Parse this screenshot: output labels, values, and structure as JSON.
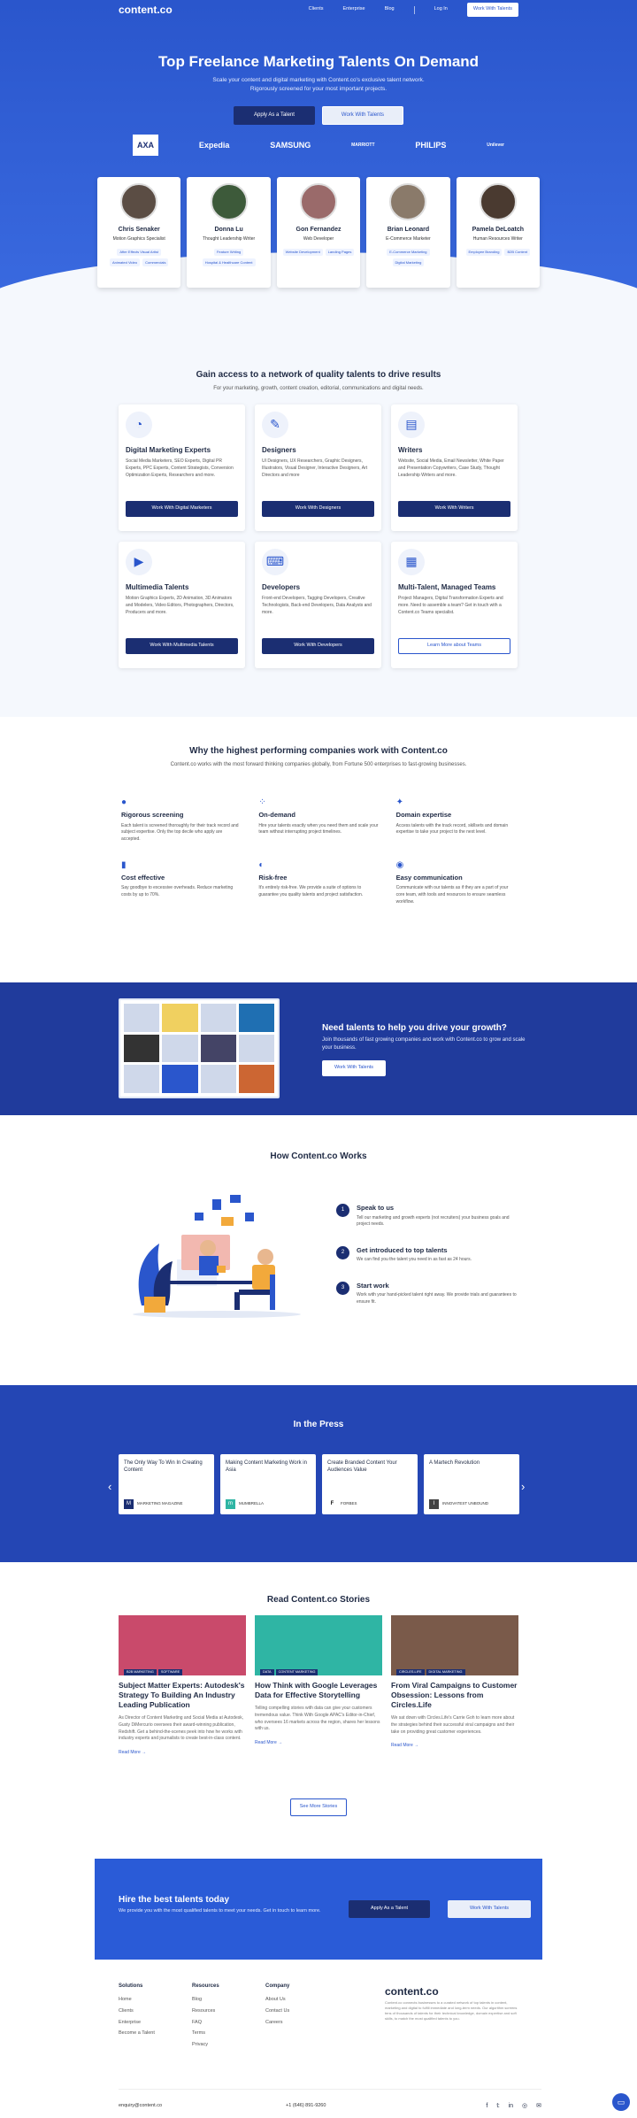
{
  "nav": {
    "logo": "content.co",
    "links": [
      "Clients",
      "Enterprise",
      "Blog",
      "Log In"
    ],
    "cta": "Work With Talents"
  },
  "hero": {
    "title": "Top Freelance Marketing Talents On Demand",
    "subtitle": "Scale your content and digital marketing with Content.co's exclusive talent network. Rigorously screened for your most important projects.",
    "btn_apply": "Apply As a Talent",
    "btn_work": "Work With Talents",
    "brands": [
      "AXA",
      "Expedia",
      "SAMSUNG",
      "MARRIOTT",
      "PHILIPS",
      "Unilever"
    ]
  },
  "talents": [
    {
      "name": "Chris Senaker",
      "role": "Motion Graphics Specialist",
      "tags": [
        "After Effects Visual Artist",
        "Animated Video",
        "Commercials"
      ]
    },
    {
      "name": "Donna Lu",
      "role": "Thought Leadership Writer",
      "tags": [
        "Feature Writing",
        "Hospital & Healthcare Content"
      ]
    },
    {
      "name": "Gon Fernandez",
      "role": "Web Developer",
      "tags": [
        "Website Development",
        "Landing Pages"
      ]
    },
    {
      "name": "Brian Leonard",
      "role": "E-Commerce Marketer",
      "tags": [
        "E-Commerce Marketing",
        "Digital Marketing"
      ]
    },
    {
      "name": "Pamela DeLoatch",
      "role": "Human Resources Writer",
      "tags": [
        "Employee Branding",
        "B2B Content"
      ]
    }
  ],
  "access": {
    "title": "Gain access to a network of quality talents to drive results",
    "subtitle": "For your marketing, growth, content creation, editorial, communications and digital needs.",
    "cards": [
      {
        "title": "Digital Marketing Experts",
        "desc": "Social Media Marketers, SEO Experts, Digital PR Experts, PPC Experts, Content Strategists, Conversion Optimization Experts, Researchers and more.",
        "btn": "Work With Digital Marketers"
      },
      {
        "title": "Designers",
        "desc": "UI Designers, UX Researchers, Graphic Designers, Illustrators, Visual Designer, Interactive Designers, Art Directors and more",
        "btn": "Work With Designers"
      },
      {
        "title": "Writers",
        "desc": "Website, Social Media, Email Newsletter, White Paper and Presentation Copywriters, Case Study, Thought Leadership Writers and more.",
        "btn": "Work With Writers"
      },
      {
        "title": "Multimedia Talents",
        "desc": "Motion Graphics Experts, 2D Animation, 3D Animators and Modelers, Video Editors, Photographers, Directors, Producers and more.",
        "btn": "Work With Multimedia Talents"
      },
      {
        "title": "Developers",
        "desc": "Front-end Developers, Tagging Developers, Creative Technologists, Back-end Developers, Data Analysts and more.",
        "btn": "Work With Developers"
      },
      {
        "title": "Multi-Talent, Managed Teams",
        "desc": "Project Managers, Digital Transformation Experts and more. Need to assemble a team? Get in touch with a Content.co Teams specialist.",
        "btn": "Learn More about Teams"
      }
    ]
  },
  "why": {
    "title": "Why the highest performing companies work with Content.co",
    "subtitle": "Content.co works with the most forward thinking companies globally, from Fortune 500 enterprises to fast-growing businesses.",
    "items": [
      {
        "title": "Rigorous screening",
        "desc": "Each talent is screened thoroughly for their track record and subject expertise. Only the top decile who apply are accepted."
      },
      {
        "title": "On-demand",
        "desc": "Hire your talents exactly when you need them and scale your team without interrupting project timelines."
      },
      {
        "title": "Domain expertise",
        "desc": "Access talents with the track record, skillsets and domain expertise to take your project to the next level."
      },
      {
        "title": "Cost effective",
        "desc": "Say goodbye to excessive overheads. Reduce marketing costs by up to 70%."
      },
      {
        "title": "Risk-free",
        "desc": "It's entirely risk-free. We provide a suite of options to guarantee you quality talents and project satisfaction."
      },
      {
        "title": "Easy communication",
        "desc": "Communicate with our talents as if they are a part of your core team, with tools and resources to ensure seamless workflow."
      }
    ]
  },
  "band": {
    "title": "Need talents to help you drive your growth?",
    "subtitle": "Join thousands of fast growing companies and work with Content.co to grow and scale your business.",
    "btn": "Work With Talents"
  },
  "how": {
    "title": "How Content.co Works",
    "steps": [
      {
        "n": "1",
        "title": "Speak to us",
        "desc": "Tell our marketing and growth experts (not recruiters) your business goals and project needs."
      },
      {
        "n": "2",
        "title": "Get introduced to top talents",
        "desc": "We can find you the talent you need in as fast as 24 hours."
      },
      {
        "n": "3",
        "title": "Start work",
        "desc": "Work with your hand-picked talent right away. We provide trials and guarantees to ensure fit."
      }
    ]
  },
  "press": {
    "title": "In the Press",
    "items": [
      {
        "title": "The Only Way To Win In Creating Content",
        "source": "MARKETING MAGAZINE",
        "logo": "M"
      },
      {
        "title": "Making Content Marketing Work in Asia",
        "source": "MUMBRELLA",
        "logo": "m"
      },
      {
        "title": "Create Branded Content Your Audiences Value",
        "source": "FORBES",
        "logo": "F"
      },
      {
        "title": "A Martech Revolution",
        "source": "INNOVATEST UNBOUND",
        "logo": "I"
      }
    ]
  },
  "stories": {
    "title": "Read Content.co Stories",
    "items": [
      {
        "labels": [
          "B2B MARKETING",
          "SOFTWARE"
        ],
        "title": "Subject Matter Experts: Autodesk's Strategy To Building An Industry Leading Publication",
        "desc": "As Director of Content Marketing and Social Media at Autodesk, Gusty DiMercurio oversees their award-winning publication, Redshift. Get a behind-the-scenes peek into how he works with industry experts and journalists to create best-in-class content.",
        "more": "Read More →",
        "color": "#c94a6b"
      },
      {
        "labels": [
          "DATA",
          "CONTENT MARKETING"
        ],
        "title": "How Think with Google Leverages Data for Effective Storytelling",
        "desc": "Telling compelling stories with data can give your customers tremendous value. Think With Google APAC's Editor-in-Chief, who oversees 16 markets across the region, shares her lessons with us.",
        "more": "Read More →",
        "color": "#2fb5a4"
      },
      {
        "labels": [
          "CIRCLES.LIFE",
          "DIGITAL MARKETING"
        ],
        "title": "From Viral Campaigns to Customer Obsession: Lessons from Circles.Life",
        "desc": "We sat down with Circles.Life's Carrie Goh to learn more about the strategies behind their successful viral campaigns and their take on providing great customer experiences.",
        "more": "Read More →",
        "color": "#7a5a4a"
      }
    ],
    "more_btn": "See More Stories"
  },
  "cta": {
    "title": "Hire the best talents today",
    "subtitle": "We provide you with the most qualified talents to meet your needs. Get in touch to learn more.",
    "btn_apply": "Apply As a Talent",
    "btn_work": "Work With Talents"
  },
  "footer": {
    "cols": [
      {
        "title": "Solutions",
        "links": [
          "Home",
          "Clients",
          "Enterprise",
          "Become a Talent"
        ]
      },
      {
        "title": "Resources",
        "links": [
          "Blog",
          "Resources",
          "FAQ",
          "Terms",
          "Privacy"
        ]
      },
      {
        "title": "Company",
        "links": [
          "About Us",
          "Contact Us",
          "Careers"
        ]
      }
    ],
    "logo": "content.co",
    "desc": "Content.co connects businesses to a curated network of top talents in content, marketing and digital to fulfill immediate and long-term needs. Our algorithm screens tens of thousands of talents for their technical knowledge, domain expertise and soft skills, to match the most qualified talents to you.",
    "email": "enquiry@content.co",
    "phone": "+1 (646) 891-9260"
  }
}
